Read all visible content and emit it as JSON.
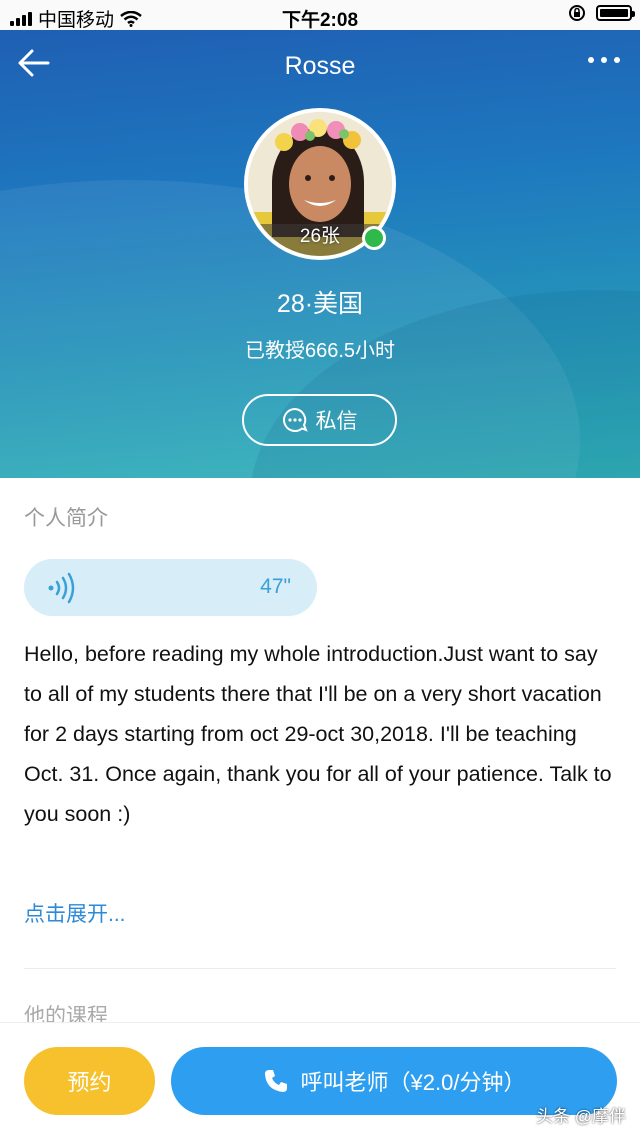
{
  "status_bar": {
    "carrier": "中国移动",
    "time": "下午2:08",
    "icons": [
      "signal-icon",
      "wifi-icon",
      "orientation-lock-icon",
      "battery-icon"
    ]
  },
  "header": {
    "title": "Rosse",
    "back_icon": "arrow-left-icon",
    "more_icon": "more-dots-icon"
  },
  "profile": {
    "photo_count": "26张",
    "online": true,
    "age_country": "28·美国",
    "teaching_hours": "已教授666.5小时",
    "message_button": "私信"
  },
  "intro": {
    "section_title": "个人简介",
    "audio_duration": "47\"",
    "text": "Hello, before reading my whole introduction.Just want to say to all of my students there that I'll be on a very short vacation for 2 days starting from oct 29-oct 30,2018. I'll be teaching Oct. 31. Once again, thank you for all of your patience. Talk to you soon :)",
    "expand_link": "点击展开..."
  },
  "courses": {
    "section_title": "他的课程"
  },
  "bottom_bar": {
    "book_button": "预约",
    "call_button": "呼叫老师（¥2.0/分钟）"
  },
  "watermark": "头条 @摩伴",
  "colors": {
    "hero_top": "#1f5fb3",
    "hero_bottom": "#31b3b7",
    "book_button": "#f6c12d",
    "call_button": "#2e9ff0",
    "online": "#2fb94b",
    "link": "#2d8ad8"
  }
}
